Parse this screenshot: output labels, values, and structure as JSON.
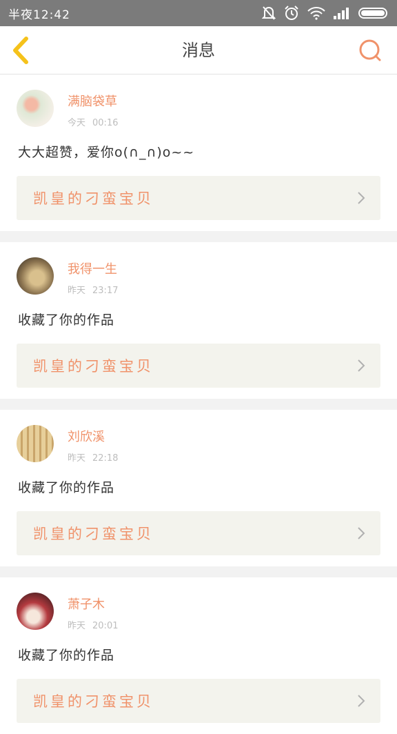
{
  "status_bar": {
    "time": "半夜12:42",
    "icons": [
      "mute-icon",
      "alarm-icon",
      "wifi-icon",
      "signal-icon",
      "battery-icon"
    ]
  },
  "nav": {
    "title": "消息",
    "back_icon": "chevron-left-icon",
    "search_icon": "search-icon"
  },
  "colors": {
    "accent": "#f0926a",
    "back_icon": "#f5c21b",
    "status_bar_bg": "#7b7b7b",
    "card_link_bg": "#f3f3ed"
  },
  "messages": [
    {
      "user": "满脑袋草",
      "day": "今天",
      "time": "00:16",
      "text": "大大超赞，爱你o(∩_∩)o~~",
      "work": "凯皇的刁蛮宝贝"
    },
    {
      "user": "我得一生",
      "day": "昨天",
      "time": "23:17",
      "text": "收藏了你的作品",
      "work": "凯皇的刁蛮宝贝"
    },
    {
      "user": "刘欣溪",
      "day": "昨天",
      "time": "22:18",
      "text": "收藏了你的作品",
      "work": "凯皇的刁蛮宝贝"
    },
    {
      "user": "萧子木",
      "day": "昨天",
      "time": "20:01",
      "text": "收藏了你的作品",
      "work": "凯皇的刁蛮宝贝"
    }
  ]
}
